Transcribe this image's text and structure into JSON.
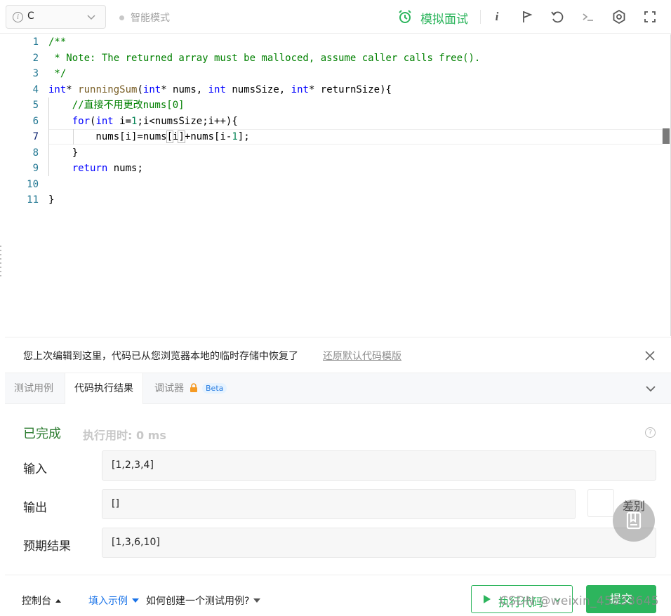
{
  "toolbar": {
    "language": "C",
    "smart_mode": "智能模式",
    "mock_interview": "模拟面试",
    "info_glyph": "i",
    "colors": {
      "accent": "#2db55d"
    }
  },
  "editor": {
    "line_numbers": [
      "1",
      "2",
      "3",
      "4",
      "5",
      "6",
      "7",
      "8",
      "9",
      "10",
      "11"
    ]
  },
  "banner": {
    "message": "您上次编辑到这里，代码已从您浏览器本地的临时存储中恢复了",
    "restore_link": "还原默认代码模版"
  },
  "tabs": {
    "test_cases": "测试用例",
    "result": "代码执行结果",
    "debugger": "调试器",
    "beta": "Beta"
  },
  "result": {
    "status": "已完成",
    "runtime": "执行用时:  0 ms",
    "help": "?",
    "input_label": "输入",
    "input_value": "[1,2,3,4]",
    "output_label": "输出",
    "output_value": "[]",
    "diff_label": "差别",
    "expected_label": "预期结果",
    "expected_value": "[1,3,6,10]"
  },
  "bottom": {
    "console": "控制台",
    "fill_example": "填入示例",
    "how_to": "如何创建一个测试用例?",
    "run": "执行代码",
    "submit": "提交",
    "watermark": "CSDN @weixin_45833645"
  }
}
